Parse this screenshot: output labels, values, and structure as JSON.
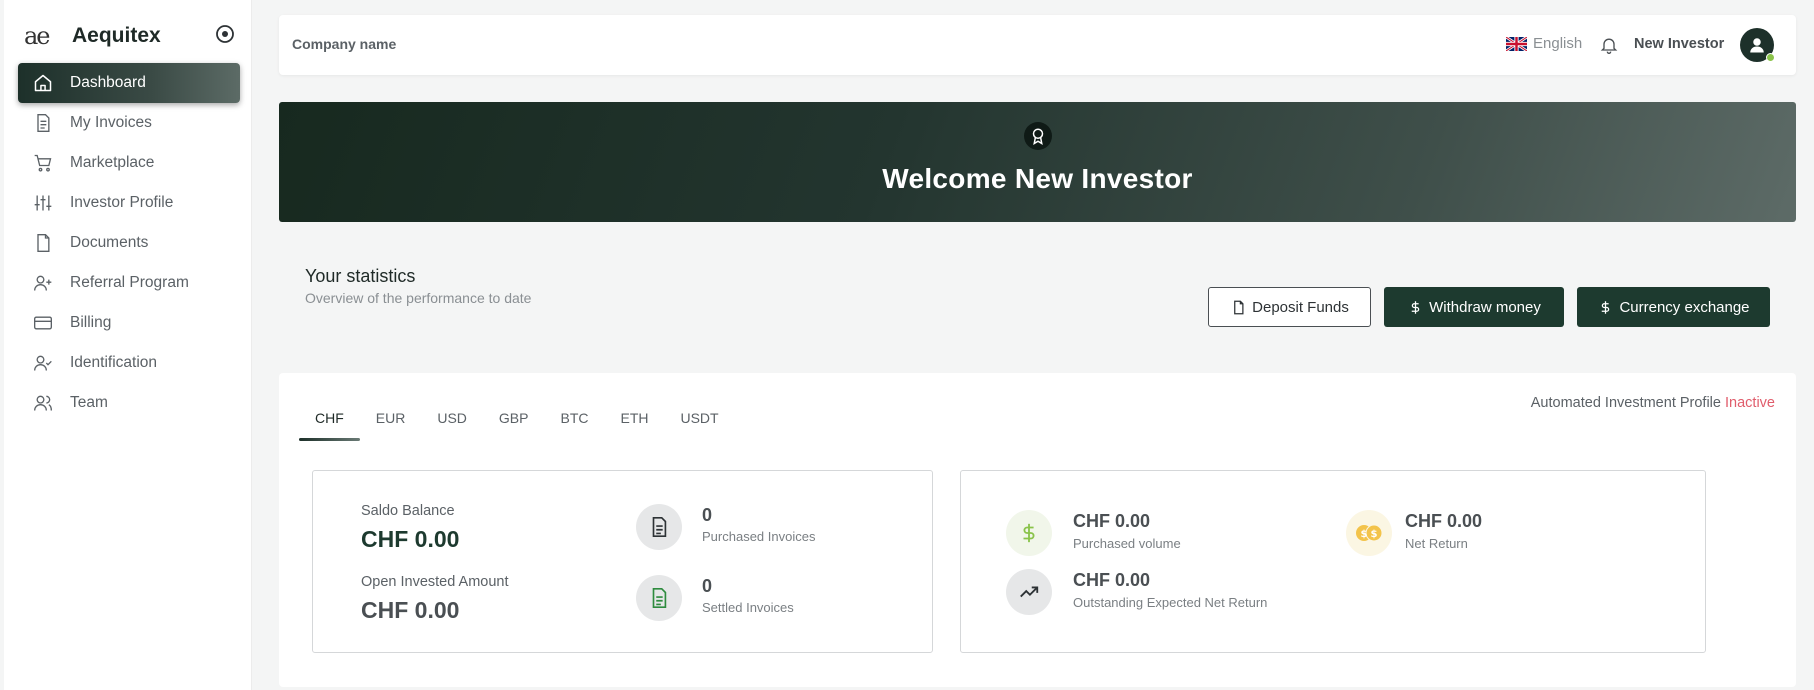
{
  "brand": {
    "name": "Aequitex",
    "logo_text": "ae"
  },
  "sidebar": {
    "items": [
      {
        "label": "Dashboard",
        "icon": "home-icon",
        "active": true
      },
      {
        "label": "My Invoices",
        "icon": "invoice-icon"
      },
      {
        "label": "Marketplace",
        "icon": "cart-icon"
      },
      {
        "label": "Investor Profile",
        "icon": "sliders-icon"
      },
      {
        "label": "Documents",
        "icon": "document-icon"
      },
      {
        "label": "Referral Program",
        "icon": "user-plus-icon"
      },
      {
        "label": "Billing",
        "icon": "credit-card-icon"
      },
      {
        "label": "Identification",
        "icon": "user-check-icon"
      },
      {
        "label": "Team",
        "icon": "users-icon"
      }
    ]
  },
  "header": {
    "company_label": "Company name",
    "language": "English",
    "user_name": "New Investor"
  },
  "banner": {
    "title": "Welcome New Investor"
  },
  "stats": {
    "title": "Your statistics",
    "subtitle": "Overview of the performance to date",
    "buttons": {
      "deposit": "Deposit Funds",
      "withdraw": "Withdraw money",
      "exchange": "Currency exchange"
    }
  },
  "tabs": [
    "CHF",
    "EUR",
    "USD",
    "GBP",
    "BTC",
    "ETH",
    "USDT"
  ],
  "active_tab": "CHF",
  "auto_profile": {
    "label": "Automated Investment Profile",
    "status": "Inactive"
  },
  "left_box": {
    "saldo_label": "Saldo Balance",
    "saldo_value": "CHF 0.00",
    "open_label": "Open Invested Amount",
    "open_value": "CHF 0.00",
    "purchased_count": "0",
    "purchased_label": "Purchased Invoices",
    "settled_count": "0",
    "settled_label": "Settled Invoices"
  },
  "right_box": {
    "volume_value": "CHF 0.00",
    "volume_label": "Purchased volume",
    "net_return_value": "CHF 0.00",
    "net_return_label": "Net Return",
    "outstanding_value": "CHF 0.00",
    "outstanding_label": "Outstanding Expected Net Return"
  },
  "colors": {
    "accent": "#1d3a2f",
    "inactive": "#e05d6c",
    "online": "#8ac34a"
  }
}
